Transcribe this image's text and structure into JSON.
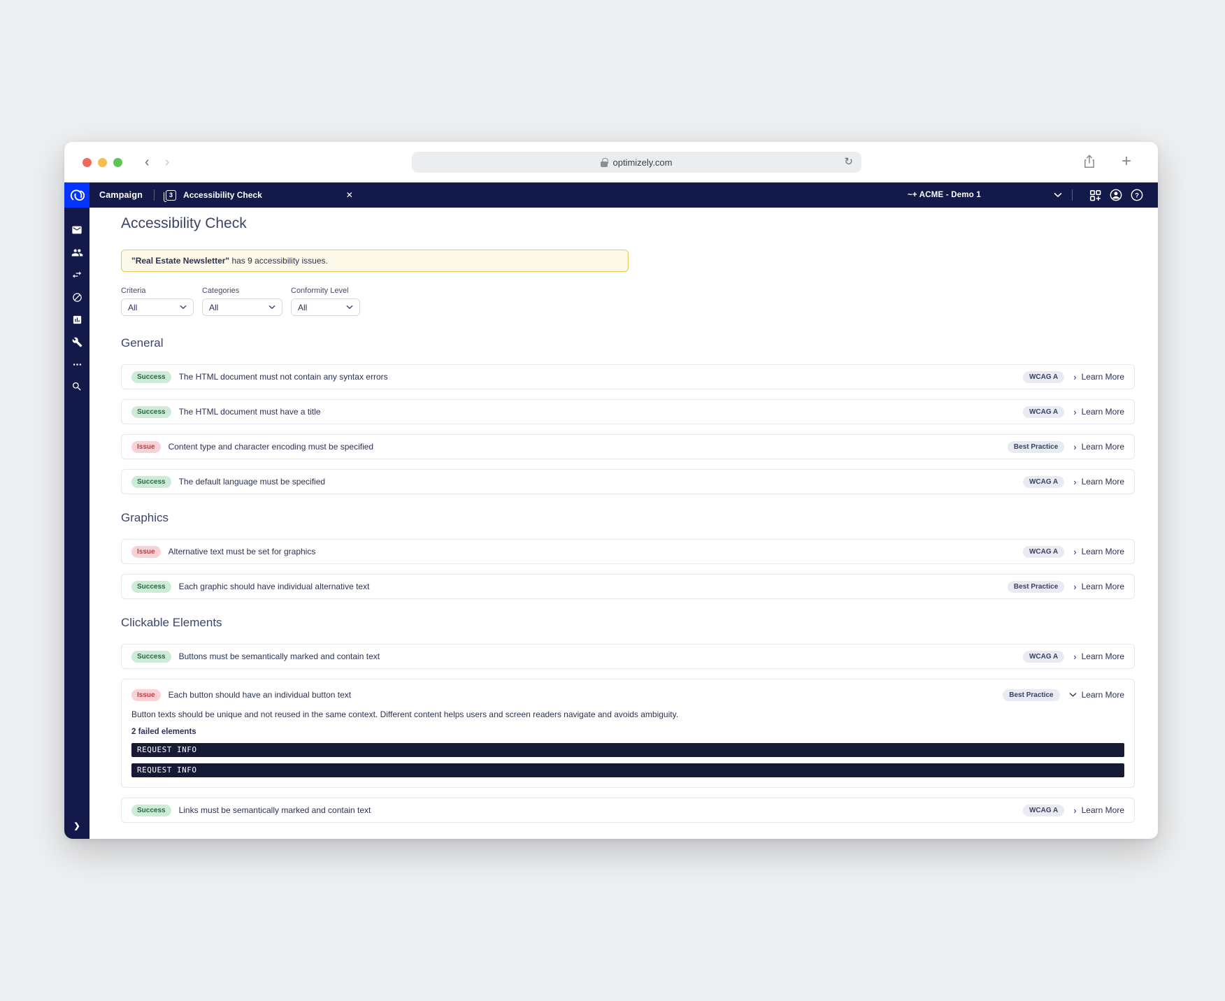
{
  "browser": {
    "url": "optimizely.com"
  },
  "app_bar": {
    "product": "Campaign",
    "tab": {
      "label": "Accessibility Check",
      "badge": "3"
    },
    "account": "~+ ACME - Demo 1"
  },
  "icons": {
    "close": "✕",
    "back_chevron": "‹",
    "forward_chevron": "›",
    "reload": "↻",
    "plus": "+",
    "chevron_right": "›",
    "help_glyph": "?",
    "bottom_chevron": "❯"
  },
  "colors": {
    "navy_bar": "#131a4a",
    "brand_blue": "#0333ff",
    "success_bg": "#cdebd7",
    "success_text": "#1e6b45",
    "issue_bg": "#f8d2d4",
    "issue_text": "#c53b43",
    "alert_bg": "#fdf9e9",
    "alert_border": "#e7c75f",
    "code_bar_bg": "#161a34"
  },
  "page": {
    "title": "Accessibility Check",
    "alert": {
      "subject": "\"Real Estate Newsletter\"",
      "rest": " has 9 accessibility issues."
    },
    "filters": [
      {
        "label": "Criteria",
        "value": "All"
      },
      {
        "label": "Categories",
        "value": "All"
      },
      {
        "label": "Conformity Level",
        "value": "All"
      }
    ],
    "learn_more": "Learn More",
    "sections": [
      {
        "title": "General",
        "rows": [
          {
            "status": "Success",
            "text": "The HTML document must not contain any syntax errors",
            "tag": "WCAG A"
          },
          {
            "status": "Success",
            "text": "The HTML document must have a title",
            "tag": "WCAG A"
          },
          {
            "status": "Issue",
            "text": "Content type and character encoding must be specified",
            "tag": "Best Practice"
          },
          {
            "status": "Success",
            "text": "The default language must be specified",
            "tag": "WCAG A"
          }
        ]
      },
      {
        "title": "Graphics",
        "rows": [
          {
            "status": "Issue",
            "text": "Alternative text must be set for graphics",
            "tag": "WCAG A"
          },
          {
            "status": "Success",
            "text": "Each graphic should have individual alternative text",
            "tag": "Best Practice"
          }
        ]
      },
      {
        "title": "Clickable Elements",
        "rows": [
          {
            "status": "Success",
            "text": "Buttons must be semantically marked and contain text",
            "tag": "WCAG A"
          },
          {
            "status": "Issue",
            "text": "Each button should have an individual button text",
            "tag": "Best Practice",
            "description": "Button texts should be unique and not reused in the same context. Different content helps users and screen readers navigate and avoids ambiguity.",
            "failed_label": "2 failed elements",
            "failed_elements": [
              "REQUEST INFO",
              "REQUEST INFO"
            ]
          },
          {
            "status": "Success",
            "text": "Links must be semantically marked and contain text",
            "tag": "WCAG A"
          }
        ]
      }
    ]
  }
}
